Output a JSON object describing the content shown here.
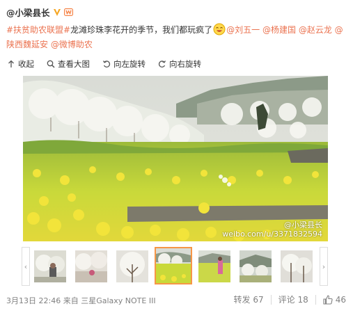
{
  "author": {
    "name": "@小梁县长"
  },
  "post": {
    "tag": "#扶贫助农联盟#",
    "text": "龙滩珍珠李花开的季节，我们都玩疯了",
    "mentions": [
      "@刘五一",
      "@杨建国",
      "@赵云龙",
      "@陕西魏延安",
      "@微博助农"
    ]
  },
  "actions": {
    "collapse": "收起",
    "view_large": "查看大图",
    "rotate_left": "向左旋转",
    "rotate_right": "向右旋转"
  },
  "watermark": {
    "user": "@小梁县长",
    "url": "weibo.com/u/3371832594"
  },
  "thumbnails": {
    "count": 7,
    "selected_index": 3
  },
  "footer": {
    "time": "3月13日 22:46",
    "via": "来自",
    "device": "三星Galaxy NOTE III"
  },
  "stats": {
    "repost": "转发 67",
    "comment": "评论 18",
    "like": "46"
  },
  "colors": {
    "link": "#eb7350",
    "selected_border": "#f79646"
  }
}
